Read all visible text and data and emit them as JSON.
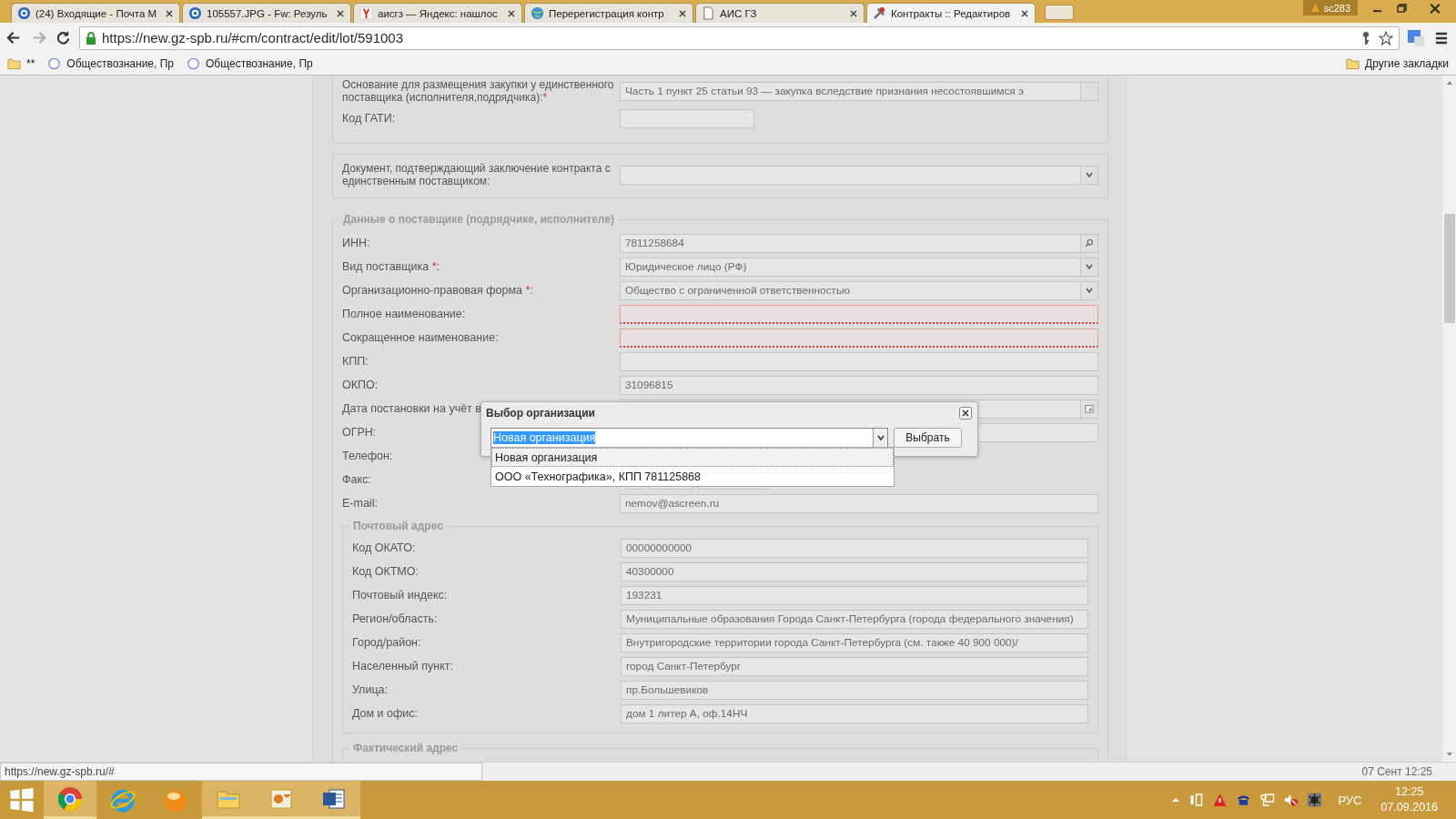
{
  "browser": {
    "tabs": [
      {
        "title": "(24) Входящие - Почта M",
        "kind": "mail",
        "selected": false
      },
      {
        "title": "105557.JPG - Fw: Резуль",
        "kind": "mail",
        "selected": false
      },
      {
        "title": "аисгз — Яндекс: нашлос",
        "kind": "yandex",
        "selected": false
      },
      {
        "title": "Перерегистрация контр",
        "kind": "globe",
        "selected": false
      },
      {
        "title": "АИС ГЗ",
        "kind": "doc",
        "selected": false
      },
      {
        "title": "Контракты :: Редактиров",
        "kind": "tools",
        "selected": true
      }
    ],
    "profile": "sc283",
    "url": "https://new.gz-spb.ru/#cm/contract/edit/lot/591003",
    "bookmarks": [
      {
        "label": "**",
        "kind": "folder"
      },
      {
        "label": "Обществознание, Пр",
        "kind": "site"
      },
      {
        "label": "Обществознание, Пр",
        "kind": "site"
      }
    ],
    "other_bookmarks": "Другие закладки",
    "status_url": "https://new.gz-spb.ru/#"
  },
  "form": {
    "basis": {
      "label": "Основание для размещения закупки у единственного поставщика (исполнителя,подрядчика):",
      "required_mark": "*",
      "value": "Часть 1 пункт 25 статьи 93 — закупка вследствие признания несостоявшимся э"
    },
    "gati": {
      "label": "Код ГАТИ:"
    },
    "document": {
      "label": "Документ, подтверждающий заключение контракта с единственным поставщиком:"
    },
    "supplier": {
      "legend": "Данные о поставщике (подрядчике, исполнителе)",
      "rows": [
        {
          "label": "ИНН:",
          "kind": "search",
          "value": "7811258684"
        },
        {
          "label": "Вид поставщика ",
          "required_mark": "*",
          "label_end": ":",
          "kind": "select",
          "value": "Юридическое лицо (РФ)"
        },
        {
          "label": "Организационно-правовая форма ",
          "required_mark": "*",
          "label_end": ":",
          "kind": "select",
          "value": "Общество с ограниченной ответственностью"
        },
        {
          "label": "Полное наименование:",
          "kind": "text",
          "invalid": true
        },
        {
          "label": "Сокращенное наименование:",
          "kind": "text",
          "invalid": true
        },
        {
          "label": "КПП:",
          "kind": "text",
          "invalid": false
        },
        {
          "label": "ОКПО:",
          "kind": "text",
          "value": "31096815",
          "invalid": false
        },
        {
          "label": "Дата постановки на учёт в",
          "kind": "date"
        },
        {
          "label": "ОГРН:",
          "kind": "text",
          "invalid": false
        },
        {
          "label": "Телефон:"
        },
        {
          "label": "Факс:",
          "kind": "phone"
        },
        {
          "label": "E-mail:",
          "kind": "text",
          "value": "nemov@ascreen.ru",
          "invalid": false
        }
      ]
    },
    "postal": {
      "legend": "Почтовый адрес",
      "rows": [
        {
          "label": "Код ОКАТО:",
          "value": "00000000000"
        },
        {
          "label": "Код ОКТМО:",
          "value": "40300000"
        },
        {
          "label": "Почтовый индекс:",
          "value": "193231"
        },
        {
          "label": "Регион/область:",
          "value": "Муниципальные образования Города Санкт-Петербурга (города федерального значения)"
        },
        {
          "label": "Город/район:",
          "value": "Внутригородские территории города Санкт-Петербурга (см. также 40 900 000)/"
        },
        {
          "label": "Населенный пункт:",
          "value": "город Санкт-Петербург"
        },
        {
          "label": "Улица:",
          "value": "пр.Большевиков"
        },
        {
          "label": "Дом и офис:",
          "value": "дом 1 литер А, оф.14НЧ"
        }
      ]
    },
    "actual": {
      "legend": "Фактический адрес"
    }
  },
  "dialog": {
    "title": "Выбор организации",
    "combo_value": "Новая организация",
    "button": "Выбрать",
    "options": [
      {
        "label": "Новая организация",
        "selected": true
      },
      {
        "label": "ООО «Технографика», КПП 781125868",
        "selected": false
      }
    ]
  },
  "footer_time": "07 Сент 12:25",
  "taskbar": {
    "apps": [
      {
        "kind": "chrome",
        "active": true
      },
      {
        "kind": "ie",
        "active": false
      },
      {
        "kind": "ball",
        "active": false
      },
      {
        "kind": "explorer",
        "active": true
      },
      {
        "kind": "outlook",
        "active": true
      },
      {
        "kind": "word",
        "active": true
      }
    ],
    "language": "РУС",
    "time": "12:25",
    "date": "07.09.2016"
  }
}
